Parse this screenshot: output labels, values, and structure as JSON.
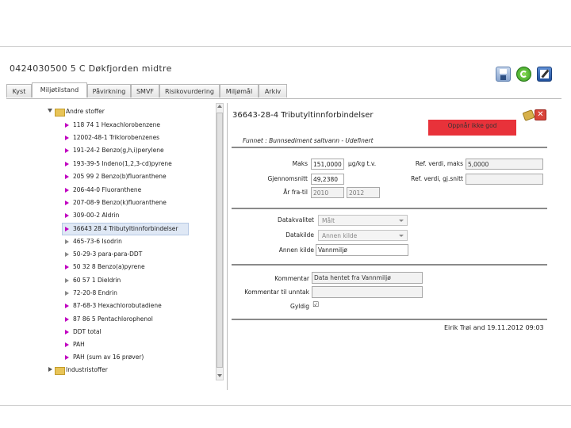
{
  "window": {
    "title": "0424030500 5 C Døkfjorden midtre"
  },
  "toolbar": {
    "save": "floppy-icon",
    "refresh": "refresh-icon",
    "edit": "edit-icon"
  },
  "tabs": [
    {
      "label": "Kyst"
    },
    {
      "label": "Miljøtilstand",
      "active": true
    },
    {
      "label": "Påvirkning"
    },
    {
      "label": "SMVF"
    },
    {
      "label": "Risikovurdering"
    },
    {
      "label": "Miljømål"
    },
    {
      "label": "Arkiv"
    }
  ],
  "tree": {
    "group": "Andre stoffer",
    "items": [
      "118 74 1 Hexachlorobenzene",
      "12002-48-1 Triklorobenzenes",
      "191-24-2 Benzo(g,h,i)perylene",
      "193-39-5 Indeno(1,2,3-cd)pyrene",
      "205 99 2 Benzo(b)fluoranthene",
      "206-44-0 Fluoranthene",
      "207-08-9 Benzo(k)fluoranthene",
      "309-00-2 Aldrin",
      "36643 28 4 Tributyltinnforbindelser",
      "465-73-6 Isodrin",
      "50-29-3 para-para-DDT",
      "50 32 8 Benzo(a)pyrene",
      "60 57 1 Dieldrin",
      "72-20-8 Endrin",
      "87-68-3 Hexachlorobutadiene",
      "87 86 5 Pentachlorophenol",
      "DDT total",
      "PAH",
      "PAH (sum av 16 prøver)"
    ],
    "selected_index": 8,
    "group2": "Industristoffer"
  },
  "detail": {
    "title": "36643-28-4 Tributyltinnforbindelser",
    "status": "Oppnår ikke god",
    "status_color": "#e8323a",
    "funnet": "Funnet : Bunnsediment saltvann - Udefinert",
    "maks_label": "Maks",
    "maks_value": "151,0000",
    "unit": "µg/kg t.v.",
    "ref_maks_label": "Ref. verdi, maks",
    "ref_maks_value": "5,0000",
    "gjennomsnitt_label": "Gjennomsnitt",
    "gjennomsnitt_value": "49,2380",
    "ref_snitt_label": "Ref. verdi, gj.snitt",
    "ref_snitt_value": "",
    "ar_label": "År fra-til",
    "ar_fra": "2010",
    "ar_til": "2012",
    "datakvalitet_label": "Datakvalitet",
    "datakvalitet_value": "Målt",
    "datakilde_label": "Datakilde",
    "datakilde_value": "Annen kilde",
    "annen_kilde_label": "Annen kilde",
    "annen_kilde_value": "Vannmiljø",
    "kommentar_label": "Kommentar",
    "kommentar_value": "Data hentet fra Vannmiljø",
    "kommentar_unntak_label": "Kommentar til unntak",
    "kommentar_unntak_value": "",
    "gyldig_label": "Gyldig",
    "gyldig_check": "☑",
    "footer": "Eirik Trøi and 19.11.2012 09:03"
  }
}
